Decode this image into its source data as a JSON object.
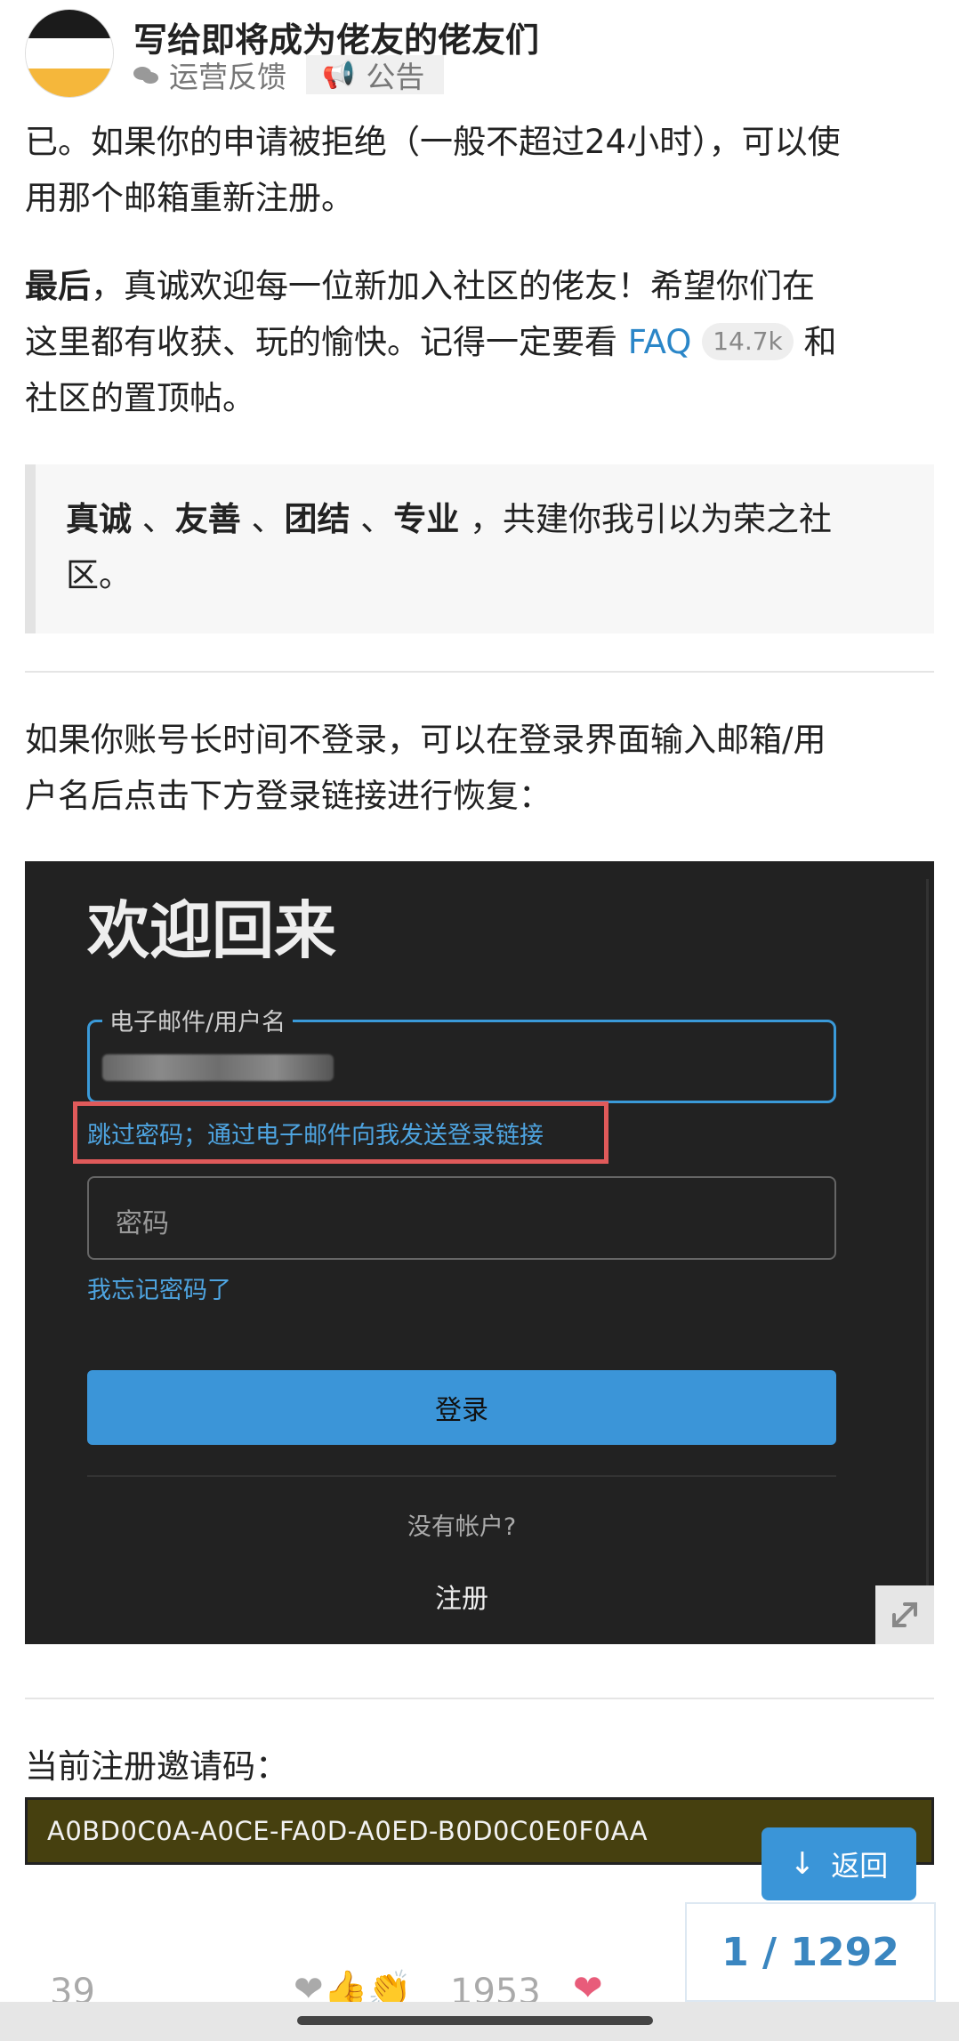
{
  "header": {
    "title": "写给即将成为佬友的佬友们",
    "category": "运营反馈",
    "tag": "公告"
  },
  "content": {
    "para1_line1": "已。如果你的申请被拒绝（一般不超过24小时），可以使",
    "para1_line2": "用那个邮箱重新注册。",
    "para2_bold": "最后",
    "para2_line1_rest": "，真诚欢迎每一位新加入社区的佬友！希望你们在",
    "para2_line2_pre": "这里都有收获、玩的愉快。记得一定要看 ",
    "faq_link": "FAQ",
    "faq_count": "14.7k",
    "para2_line2_post": " 和",
    "para2_line3": "社区的置顶帖。",
    "quote_w1": "真诚",
    "quote_sep": "、",
    "quote_w2": "友善",
    "quote_w3": "团结",
    "quote_w4": "专业",
    "quote_rest": "，共建你我引以为荣之社",
    "quote_line2": "区。",
    "para3_line1": "如果你账号长时间不登录，可以在登录界面输入邮箱/用",
    "para3_line2": "户名后点击下方登录链接进行恢复：",
    "para4": "当前注册邀请码：",
    "invite_code": "A0BD0C0A-A0CE-FA0D-A0ED-B0D0C0E0F0AA"
  },
  "screenshot": {
    "title": "欢迎回来",
    "email_label": "电子邮件/用户名",
    "skip_link": "跳过密码；通过电子邮件向我发送登录链接",
    "password_placeholder": "密码",
    "forgot": "我忘记密码了",
    "login_button": "登录",
    "no_account": "没有帐户?",
    "register": "注册"
  },
  "floating": {
    "back_label": "返回",
    "progress": "1 / 1292"
  },
  "post_footer": {
    "replies": "39",
    "reactions": "❤👍👏",
    "likes": "1953"
  },
  "colors": {
    "link": "#2a86c8",
    "accent": "#3a95d8",
    "highlight_box": "#e05a5a",
    "code_bg": "#46400f"
  }
}
